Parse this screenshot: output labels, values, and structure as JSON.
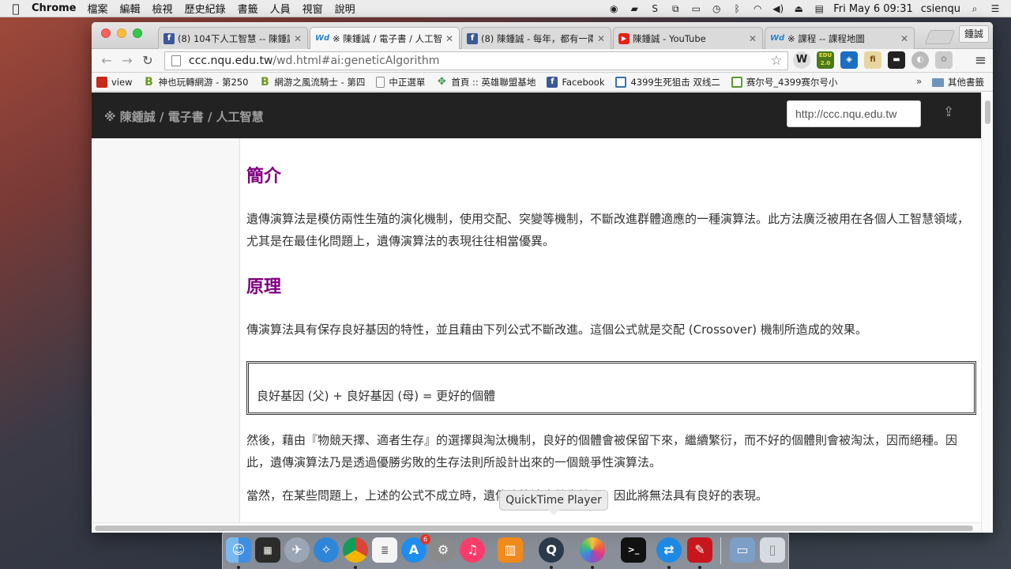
{
  "menubar": {
    "app_name": "Chrome",
    "items": [
      "檔案",
      "編輯",
      "檢視",
      "歷史紀錄",
      "書籤",
      "人員",
      "視窗",
      "說明"
    ],
    "clock": "Fri May 6  09:31",
    "user": "csienqu"
  },
  "tabs": [
    {
      "favicon": "f",
      "title": "(8) 104下人工智慧 -- 陳鍾誠"
    },
    {
      "favicon": "Wd",
      "title": "※ 陳鍾誠 / 電子書 / 人工智慧"
    },
    {
      "favicon": "f",
      "title": "(8) 陳鍾誠 - 每年，都有一兩"
    },
    {
      "favicon": "▶",
      "title": "陳鍾誠 - YouTube"
    },
    {
      "favicon": "Wd",
      "title": "※ 課程 -- 課程地圖"
    }
  ],
  "profile_button": "鍾誠",
  "address": {
    "host": "ccc.nqu.edu.tw",
    "path": "/wd.html#ai:geneticAlgorithm"
  },
  "extensions": [
    "W",
    "EDU 2.0",
    "◈",
    "fi",
    "▬",
    "◐",
    "✿"
  ],
  "bookmarks": [
    {
      "icon": "view",
      "label": "view"
    },
    {
      "icon": "B",
      "label": "神也玩轉網游 - 第250"
    },
    {
      "icon": "B",
      "label": "網游之風流騎士 - 第四"
    },
    {
      "icon": "page",
      "label": "中正選單"
    },
    {
      "icon": "gem",
      "label": "首頁 :: 英雄聯盟基地"
    },
    {
      "icon": "f",
      "label": "Facebook"
    },
    {
      "icon": "grid",
      "label": "4399生死狙击 双线二"
    },
    {
      "icon": "grid2",
      "label": "赛尔号_4399赛尔号小"
    }
  ],
  "bookmarks_more": "»",
  "bookmarks_folder": "其他書籤",
  "site": {
    "title": "※ 陳鍾誠 / 電子書 / 人工智慧",
    "share_value": "http://ccc.nqu.edu.tw"
  },
  "article": {
    "intro_heading": "簡介",
    "intro_para": "遺傳演算法是模仿兩性生殖的演化機制，使用交配、突變等機制，不斷改進群體適應的一種演算法。此方法廣泛被用在各個人工智慧領域，尤其是在最佳化問題上，遺傳演算法的表現往往相當優異。",
    "principle_heading": "原理",
    "principle_para": "傳演算法具有保存良好基因的特性，並且藉由下列公式不斷改進。這個公式就是交配 (Crossover) 機制所造成的效果。",
    "formula": "良好基因 (父) + 良好基因 (母) = 更好的個體",
    "para3": "然後，藉由『物競天擇、適者生存』的選擇與淘汰機制，良好的個體會被保留下來，繼續繁衍，而不好的個體則會被淘汰，因而絕種。因此，遺傳演算法乃是透過優勝劣敗的生存法則所設計出來的一個競爭性演算法。",
    "para4": "當然，在某些問題上，上述的公式不成立時，遺傳演算法也就失效了，因此將無法具有良好的表現。"
  },
  "tooltip": "QuickTime Player",
  "dock_badge": "6",
  "colors": {
    "heading": "#800080",
    "site_header": "#222222",
    "facebook": "#3b5998",
    "youtube": "#e62117"
  }
}
